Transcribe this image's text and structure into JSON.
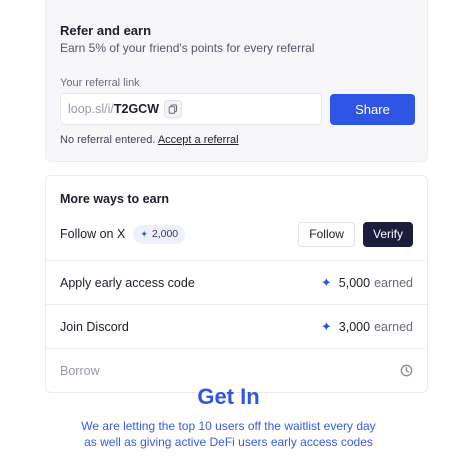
{
  "refer": {
    "title": "Refer and earn",
    "subtitle": "Earn 5% of your friend's points for every referral",
    "link_label": "Your referral link",
    "link_prefix": "loop.sl/i/",
    "link_code": "T2GCW",
    "share_label": "Share",
    "no_referral_text": "No referral entered.",
    "accept_link": "Accept a referral"
  },
  "ways": {
    "title": "More ways to earn",
    "follow_x": {
      "label": "Follow on X",
      "points": "2,000",
      "follow_label": "Follow",
      "verify_label": "Verify"
    },
    "early_access": {
      "label": "Apply early access code",
      "value": "5,000",
      "suffix": "earned"
    },
    "discord": {
      "label": "Join Discord",
      "value": "3,000",
      "suffix": "earned"
    },
    "borrow": {
      "label": "Borrow"
    }
  },
  "footer": {
    "heading": "Get In",
    "line1": "We are letting the top 10 users off the waitlist every day",
    "line2": "as well as giving active DeFi users early access codes"
  },
  "icons": {
    "copy": "copy-icon",
    "spark": "sparkle-icon",
    "clock": "clock-icon"
  },
  "colors": {
    "accent": "#2f55e4",
    "dark_button": "#1c1d3a",
    "pill_bg": "#eef0fc"
  }
}
